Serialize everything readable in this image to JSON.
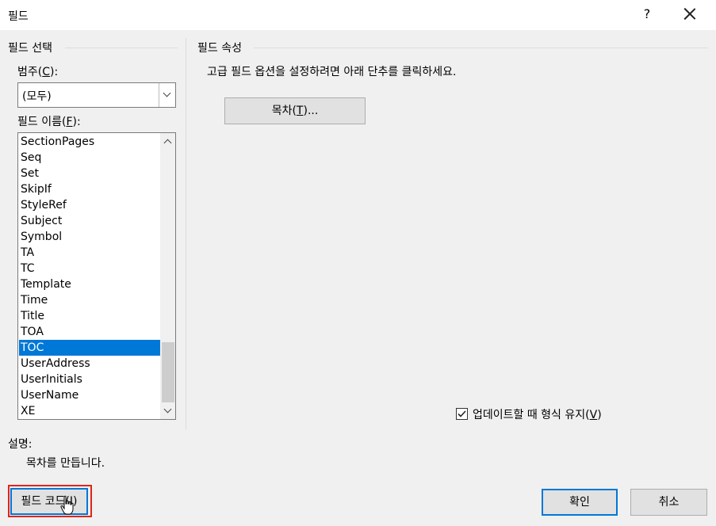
{
  "window": {
    "title": "필드",
    "help_label": "?"
  },
  "left_panel": {
    "header": "필드 선택",
    "category_label_prefix": "범주(",
    "category_label_key": "C",
    "category_label_suffix": "):",
    "category_value": "(모두)",
    "fieldname_label_prefix": "필드 이름(",
    "fieldname_label_key": "F",
    "fieldname_label_suffix": "):",
    "fields": [
      "SectionPages",
      "Seq",
      "Set",
      "SkipIf",
      "StyleRef",
      "Subject",
      "Symbol",
      "TA",
      "TC",
      "Template",
      "Time",
      "Title",
      "TOA",
      "TOC",
      "UserAddress",
      "UserInitials",
      "UserName",
      "XE"
    ],
    "selected_field": "TOC"
  },
  "right_panel": {
    "header": "필드 속성",
    "instructions": "고급 필드 옵션을 설정하려면 아래 단추를 클릭하세요.",
    "toc_button_prefix": "목차(",
    "toc_button_key": "T",
    "toc_button_suffix": ")...",
    "preserve_format_prefix": "업데이트할 때 형식 유지(",
    "preserve_format_key": "V",
    "preserve_format_suffix": ")",
    "preserve_format_checked": true
  },
  "description": {
    "label": "설명:",
    "text": "목차를 만듭니다."
  },
  "buttons": {
    "field_codes_prefix": "필드 코드(",
    "field_codes_key": "I",
    "field_codes_suffix": ")",
    "ok": "확인",
    "cancel": "취소"
  },
  "colors": {
    "selection": "#0078d7",
    "highlight_box": "#e0241b",
    "dialog_bg": "#f0f0f0"
  }
}
